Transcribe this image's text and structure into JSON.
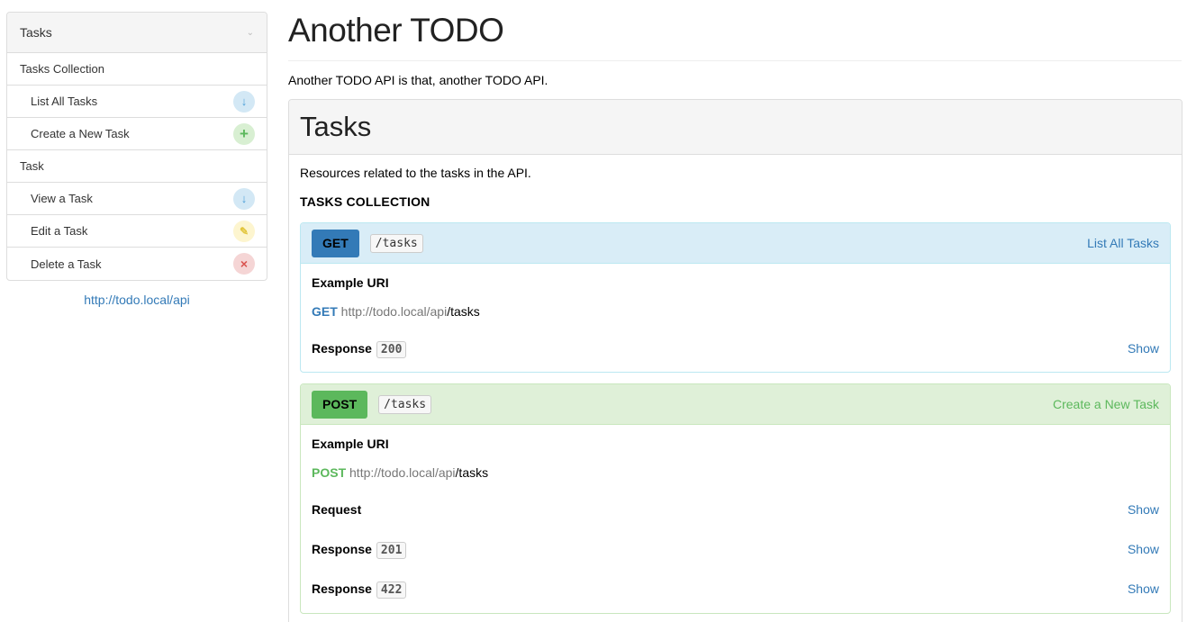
{
  "sidebar": {
    "heading": "Tasks",
    "groups": [
      {
        "label": "Tasks Collection",
        "items": [
          {
            "label": "List All Tasks",
            "icon": "arrow-down-icon"
          },
          {
            "label": "Create a New Task",
            "icon": "plus-icon"
          }
        ]
      },
      {
        "label": "Task",
        "items": [
          {
            "label": "View a Task",
            "icon": "arrow-down-icon"
          },
          {
            "label": "Edit a Task",
            "icon": "pencil-icon"
          },
          {
            "label": "Delete a Task",
            "icon": "x-icon"
          }
        ]
      }
    ],
    "api_host": "http://todo.local/api"
  },
  "main": {
    "title": "Another TODO",
    "description": "Another TODO API is that, another TODO API.",
    "group": {
      "title": "Tasks",
      "description": "Resources related to the tasks in the API.",
      "resource_title": "TASKS COLLECTION",
      "actions": [
        {
          "method": "GET",
          "uri": "/tasks",
          "name": "List All Tasks",
          "example_label": "Example URI",
          "example_host": "http://todo.local/api",
          "example_path": "/tasks",
          "rows": [
            {
              "label": "Response",
              "code": "200",
              "link": "Show"
            }
          ]
        },
        {
          "method": "POST",
          "uri": "/tasks",
          "name": "Create a New Task",
          "example_label": "Example URI",
          "example_host": "http://todo.local/api",
          "example_path": "/tasks",
          "rows": [
            {
              "label": "Request",
              "code": "",
              "link": "Show"
            },
            {
              "label": "Response",
              "code": "201",
              "link": "Show"
            },
            {
              "label": "Response",
              "code": "422",
              "link": "Show"
            }
          ]
        }
      ]
    }
  },
  "colors": {
    "get": "#337ab7",
    "post": "#5cb85c",
    "get_bg": "#d9edf7",
    "post_bg": "#dff0d8"
  }
}
